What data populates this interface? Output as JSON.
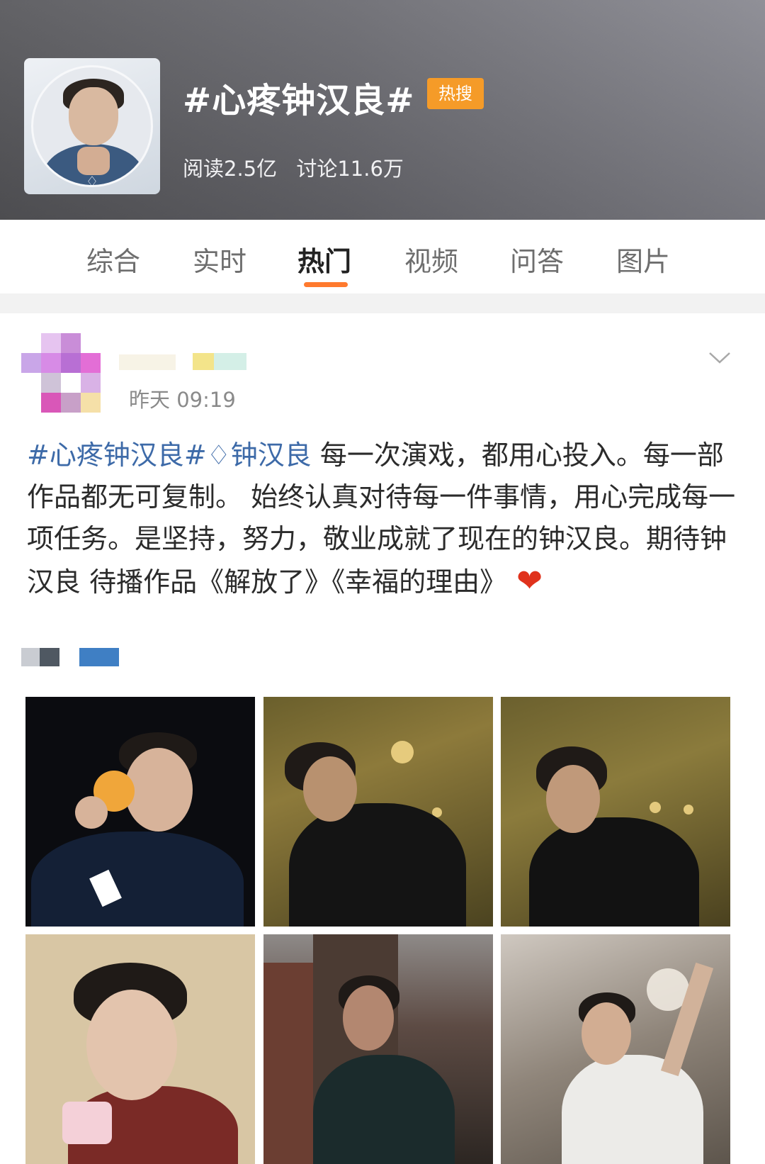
{
  "header": {
    "topic_title": "#心疼钟汉良#",
    "hot_badge": "热搜",
    "reads": "阅读2.5亿",
    "discussions": "讨论11.6万"
  },
  "tabs": [
    "综合",
    "实时",
    "热门",
    "视频",
    "问答",
    "图片"
  ],
  "active_tab": "热门",
  "post": {
    "time": "昨天 09:19",
    "tag1": "#心疼钟汉良#",
    "tag2_icon": "diamond-icon",
    "tag2": "钟汉良",
    "body": " 每一次演戏，都用心投入。每一部作品都无可复制。 始终认真对待每一件事情，用心完成每一项任务。是坚持，努力，敬业成就了现在的钟汉良。期待钟汉良 待播作品《解放了》《幸福的理由》",
    "heart": "❤"
  },
  "colors": {
    "accent": "#ff7a2e",
    "hot_badge": "#f59b28",
    "link": "#3d6aa8"
  }
}
